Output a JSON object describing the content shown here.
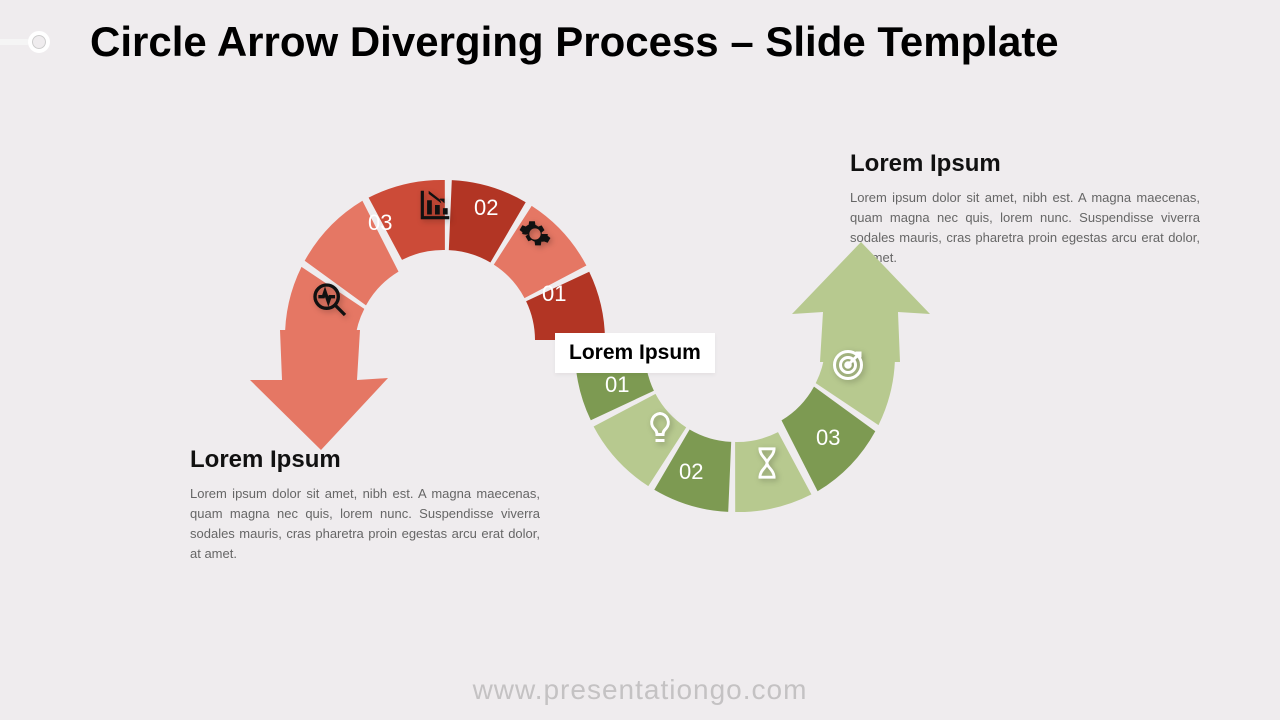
{
  "title": "Circle Arrow Diverging Process – Slide Template",
  "center_label": "Lorem Ipsum",
  "footer": "www.presentationgo.com",
  "right_block": {
    "heading": "Lorem Ipsum",
    "body": "Lorem ipsum dolor sit amet, nibh est. A magna maecenas, quam magna nec quis, lorem nunc. Suspendisse viverra sodales mauris, cras pharetra proin egestas arcu erat dolor, at amet."
  },
  "left_block": {
    "heading": "Lorem Ipsum",
    "body": "Lorem ipsum dolor sit amet, nibh est. A magna maecenas, quam magna nec quis, lorem nunc. Suspendisse viverra sodales mauris, cras pharetra proin egestas arcu erat dolor, at amet."
  },
  "red_segments": {
    "s01": "01",
    "s02": "02",
    "s03": "03"
  },
  "green_segments": {
    "s01": "01",
    "s02": "02",
    "s03": "03"
  },
  "colors": {
    "red_dark": "#b23524",
    "red_mid": "#cc4b38",
    "red_light": "#e57764",
    "green_dark": "#7d9a52",
    "green_mid": "#99b26c",
    "green_light": "#b7c98f"
  }
}
